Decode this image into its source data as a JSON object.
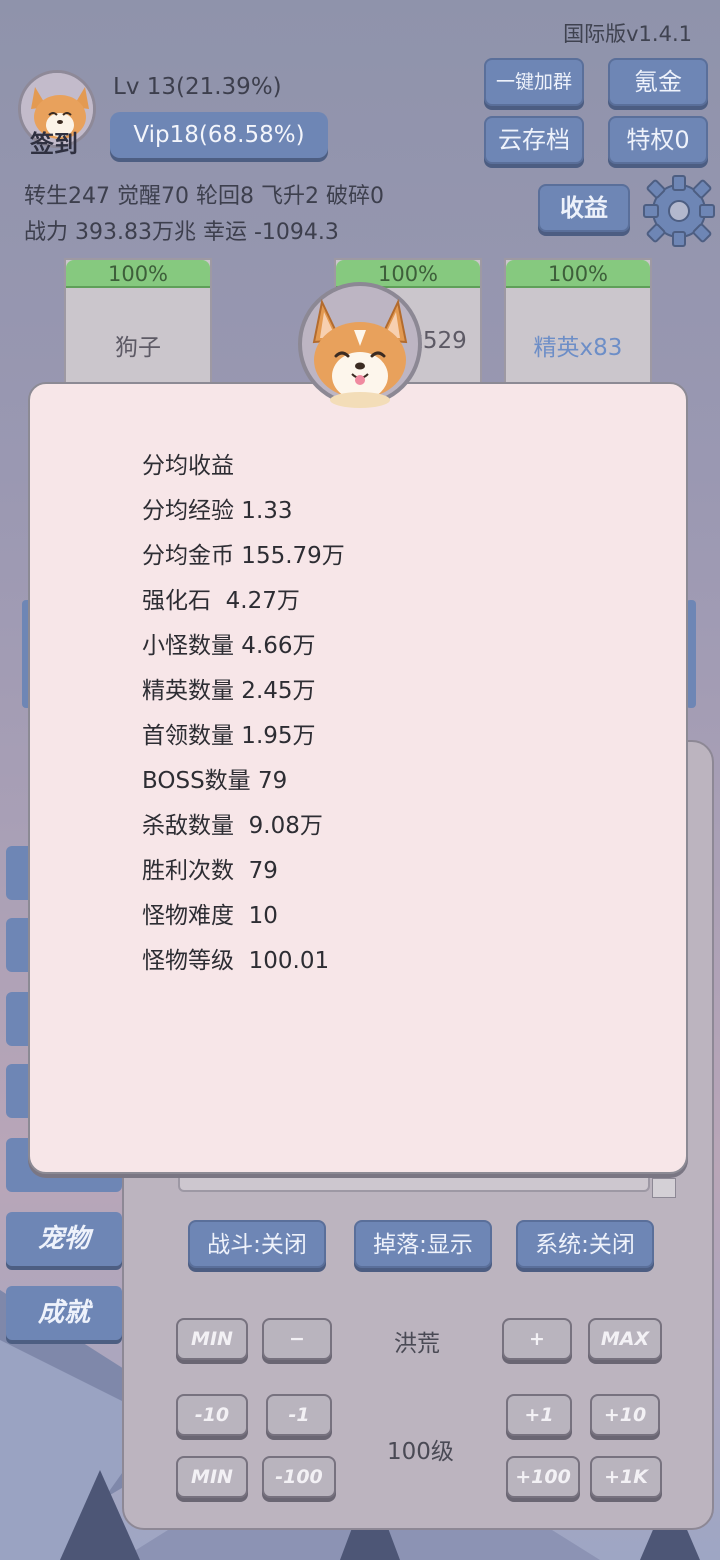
{
  "header": {
    "version": "国际版v1.4.1",
    "avatar_label": "签到",
    "level": "Lv 13(21.39%)",
    "vip": "Vip18(68.58%)",
    "stats_line1": "转生247 觉醒70 轮回8 飞升2 破碎0",
    "stats_line2": "战力 393.83万兆  幸运 -1094.3",
    "buttons": {
      "join_group": "一键加群",
      "krypton": "氪金",
      "cloud_save": "云存档",
      "privilege": "特权0",
      "income": "收益"
    }
  },
  "cards": [
    {
      "percent": "100%",
      "label": "狗子"
    },
    {
      "percent": "100%",
      "label": "x529"
    },
    {
      "percent": "100%",
      "label": "精英x83"
    }
  ],
  "modal": {
    "lines": [
      "分均收益",
      "分均经验 1.33",
      "分均金币 155.79万",
      "强化石  4.27万",
      "小怪数量 4.66万",
      "精英数量 2.45万",
      "首领数量 1.95万",
      "BOSS数量 79",
      "杀敌数量  9.08万",
      "胜利次数  79",
      "怪物难度  10",
      "怪物等级  100.01"
    ]
  },
  "side_tabs": {
    "pet": "宠物",
    "achievement": "成就"
  },
  "toggles": {
    "battle": "战斗:关闭",
    "drop": "掉落:显示",
    "system": "系统:关闭"
  },
  "controls": {
    "row1": {
      "min": "MIN",
      "minus": "−",
      "label": "洪荒",
      "plus": "+",
      "max": "MAX"
    },
    "row2": {
      "m10": "-10",
      "m1": "-1",
      "label": "100级",
      "p1": "+1",
      "p10": "+10"
    },
    "row3": {
      "min": "MIN",
      "m100": "-100",
      "p100": "+100",
      "p1k": "+1K"
    }
  },
  "colors": {
    "accent": "#6e86b5",
    "bar_green": "#86c97f",
    "modal_bg": "#f7e6e8"
  }
}
